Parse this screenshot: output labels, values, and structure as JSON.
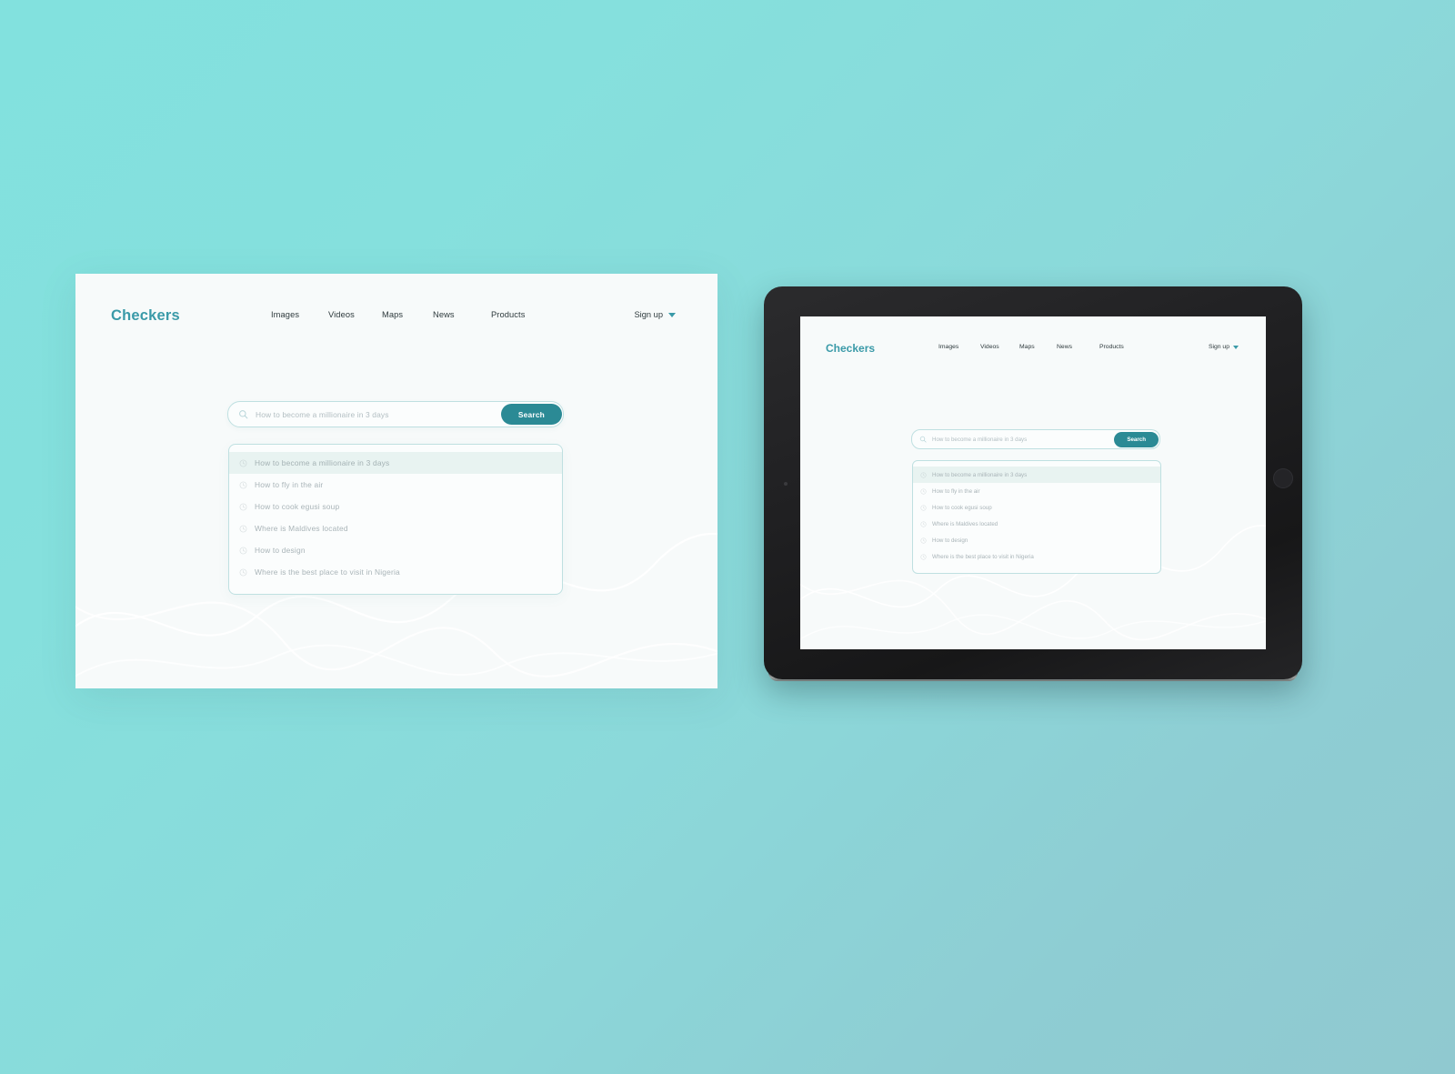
{
  "brand": {
    "name": "Checkers",
    "accent_color": "#3a9aa8",
    "button_color": "#2b8a95"
  },
  "background": {
    "gradient_from": "#82e1de",
    "gradient_to": "#90c9d0"
  },
  "nav": {
    "items": [
      {
        "label": "Images"
      },
      {
        "label": "Videos"
      },
      {
        "label": "Maps"
      },
      {
        "label": "News"
      },
      {
        "label": "Products"
      }
    ],
    "signup_label": "Sign up",
    "caret_icon": "chevron-down-icon"
  },
  "search": {
    "placeholder": "How to become a millionaire in 3 days",
    "value": "",
    "button_label": "Search",
    "icon": "search-icon"
  },
  "suggestions": {
    "item_icon": "clock-icon",
    "items": [
      {
        "label": "How to become a millionaire in 3 days",
        "active": true
      },
      {
        "label": "How to fly in the air",
        "active": false
      },
      {
        "label": "How to cook egusi soup",
        "active": false
      },
      {
        "label": "Where is Maldives located",
        "active": false
      },
      {
        "label": "How to design",
        "active": false
      },
      {
        "label": "Where is the best place to visit in Nigeria",
        "active": false
      }
    ]
  },
  "mockups": {
    "desktop_label": "desktop-mockup",
    "tablet_label": "tablet-mockup"
  }
}
